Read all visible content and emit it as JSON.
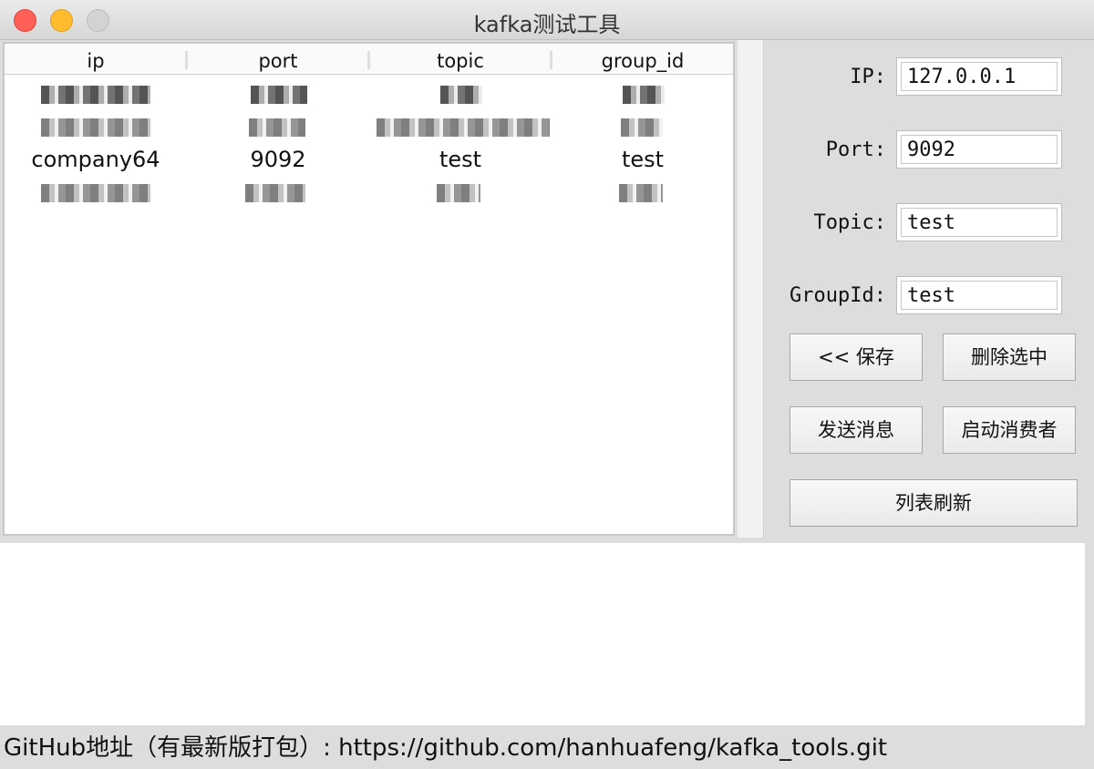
{
  "window": {
    "title": "kafka测试工具"
  },
  "table": {
    "columns": [
      "ip",
      "port",
      "topic",
      "group_id"
    ],
    "rows": [
      {
        "ip": "",
        "port": "",
        "topic": "",
        "group_id": "",
        "redacted": true
      },
      {
        "ip": "",
        "port": "",
        "topic": "",
        "group_id": "",
        "redacted": true
      },
      {
        "ip": "company64",
        "port": "9092",
        "topic": "test",
        "group_id": "test",
        "redacted": false
      },
      {
        "ip": "",
        "port": "",
        "topic": "",
        "group_id": "",
        "redacted": true
      }
    ]
  },
  "form": {
    "ip_label": "IP:",
    "ip_value": "127.0.0.1",
    "port_label": "Port:",
    "port_value": "9092",
    "topic_label": "Topic:",
    "topic_value": "test",
    "group_label": "GroupId:",
    "group_value": "test"
  },
  "buttons": {
    "save": "<< 保存",
    "delete": "删除选中",
    "send": "发送消息",
    "consume": "启动消费者",
    "refresh": "列表刷新"
  },
  "footer": {
    "text": "GitHub地址（有最新版打包）: https://github.com/hanhuafeng/kafka_tools.git"
  }
}
